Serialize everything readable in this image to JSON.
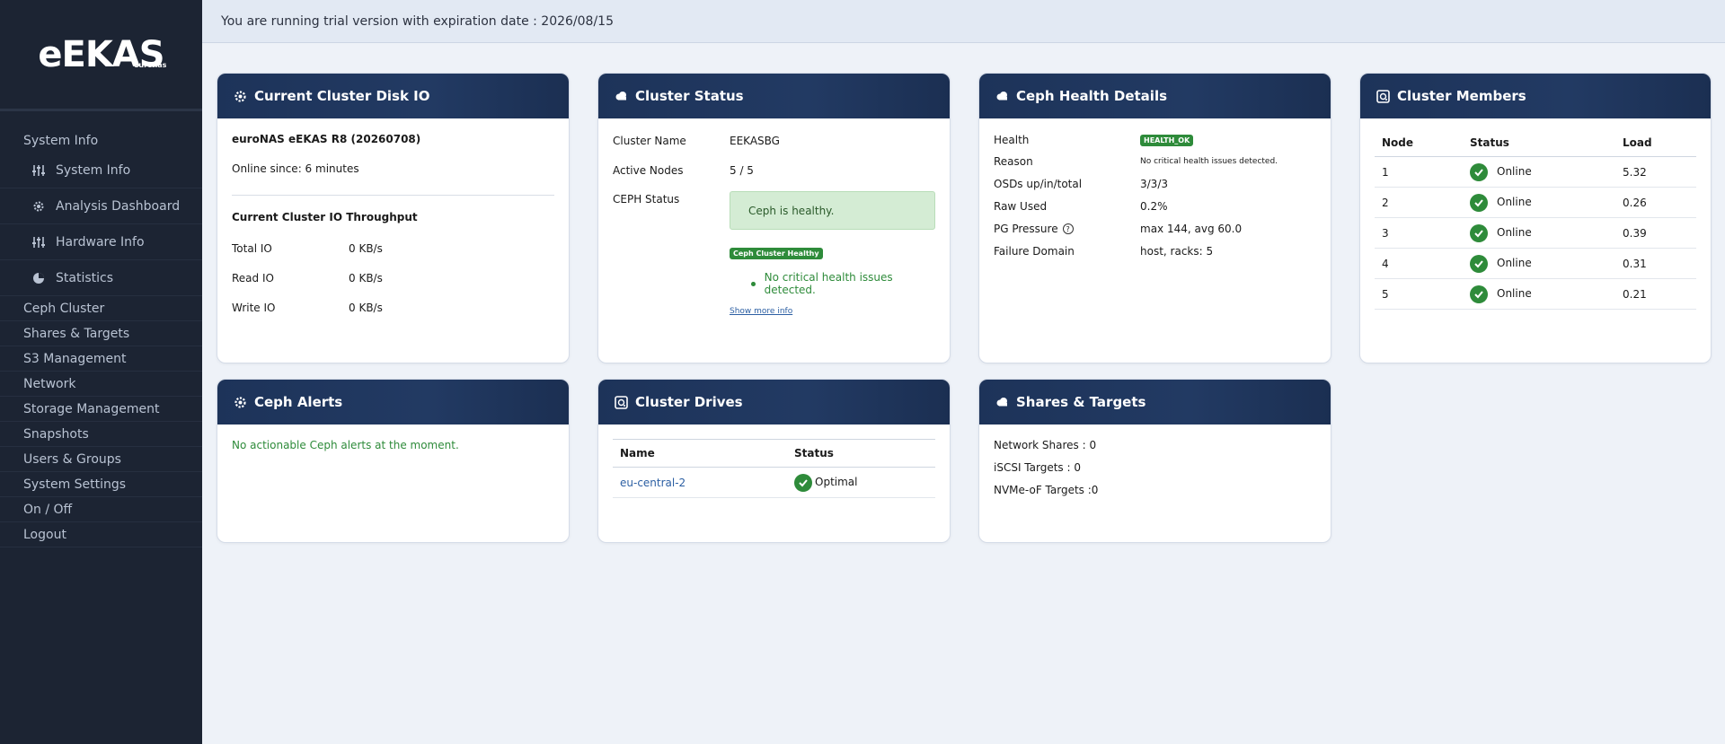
{
  "app": {
    "logo": "eEKAS",
    "logo_sub": "euronas"
  },
  "trial_banner": "You are running trial version with expiration date : 2026/08/15",
  "sidebar": {
    "items": [
      {
        "label": "System Info",
        "type": "head"
      },
      {
        "label": "System Info",
        "type": "sub",
        "icon": "sliders-icon"
      },
      {
        "label": "Analysis Dashboard",
        "type": "sub",
        "icon": "gear-icon"
      },
      {
        "label": "Hardware Info",
        "type": "sub",
        "icon": "sliders-icon"
      },
      {
        "label": "Statistics",
        "type": "sub",
        "icon": "pie-chart-icon"
      },
      {
        "label": "Ceph Cluster",
        "type": "top"
      },
      {
        "label": "Shares & Targets",
        "type": "top"
      },
      {
        "label": "S3 Management",
        "type": "top"
      },
      {
        "label": "Network",
        "type": "top"
      },
      {
        "label": "Storage Management",
        "type": "top"
      },
      {
        "label": "Snapshots",
        "type": "top"
      },
      {
        "label": "Users & Groups",
        "type": "top"
      },
      {
        "label": "System Settings",
        "type": "top"
      },
      {
        "label": "On / Off",
        "type": "top"
      },
      {
        "label": "Logout",
        "type": "top"
      }
    ]
  },
  "disk_io": {
    "title": "Current Cluster Disk IO",
    "system": "euroNAS eEKAS R8 (20260708)",
    "online_since": "Online since: 6 minutes",
    "throughput_title": "Current Cluster IO Throughput",
    "rows": [
      {
        "label": "Total IO",
        "value": "0 KB/s"
      },
      {
        "label": "Read IO",
        "value": "0 KB/s"
      },
      {
        "label": "Write IO",
        "value": "0 KB/s"
      }
    ]
  },
  "cluster_status": {
    "title": "Cluster Status",
    "name_label": "Cluster Name",
    "name_value": "EEKASBG",
    "nodes_label": "Active Nodes",
    "nodes_value": "5 / 5",
    "ceph_label": "CEPH Status",
    "ceph_box": "Ceph is healthy.",
    "badge": "Ceph Cluster Healthy",
    "bullet": "No critical health issues detected.",
    "more": "Show more info"
  },
  "ceph_health": {
    "title": "Ceph Health Details",
    "health_label": "Health",
    "health_badge": "HEALTH_OK",
    "reason_label": "Reason",
    "reason_value": "No critical health issues detected.",
    "osd_label": "OSDs up/in/total",
    "osd_value": "3/3/3",
    "raw_label": "Raw Used",
    "raw_value": "0.2%",
    "pg_label": "PG Pressure",
    "pg_value": "max 144, avg 60.0",
    "fd_label": "Failure Domain",
    "fd_value": "host, racks: 5"
  },
  "members": {
    "title": "Cluster Members",
    "headers": [
      "Node",
      "Status",
      "Load"
    ],
    "rows": [
      {
        "node": "1",
        "status": "Online",
        "load": "5.32"
      },
      {
        "node": "2",
        "status": "Online",
        "load": "0.26"
      },
      {
        "node": "3",
        "status": "Online",
        "load": "0.39"
      },
      {
        "node": "4",
        "status": "Online",
        "load": "0.31"
      },
      {
        "node": "5",
        "status": "Online",
        "load": "0.21"
      }
    ]
  },
  "alerts": {
    "title": "Ceph Alerts",
    "message": "No actionable Ceph alerts at the moment."
  },
  "drives": {
    "title": "Cluster Drives",
    "headers": [
      "Name",
      "Status"
    ],
    "rows": [
      {
        "name": "eu-central-2",
        "status": "Optimal"
      }
    ]
  },
  "shares": {
    "title": "Shares & Targets",
    "network": "Network Shares : 0",
    "iscsi": "iSCSI Targets : 0",
    "nvme": "NVMe-oF Targets :0"
  },
  "colors": {
    "sidebar_bg": "#1c2433",
    "card_header": "#1d3359",
    "healthy_green": "#2e8b3a",
    "healthy_box": "#d4ecd4"
  }
}
